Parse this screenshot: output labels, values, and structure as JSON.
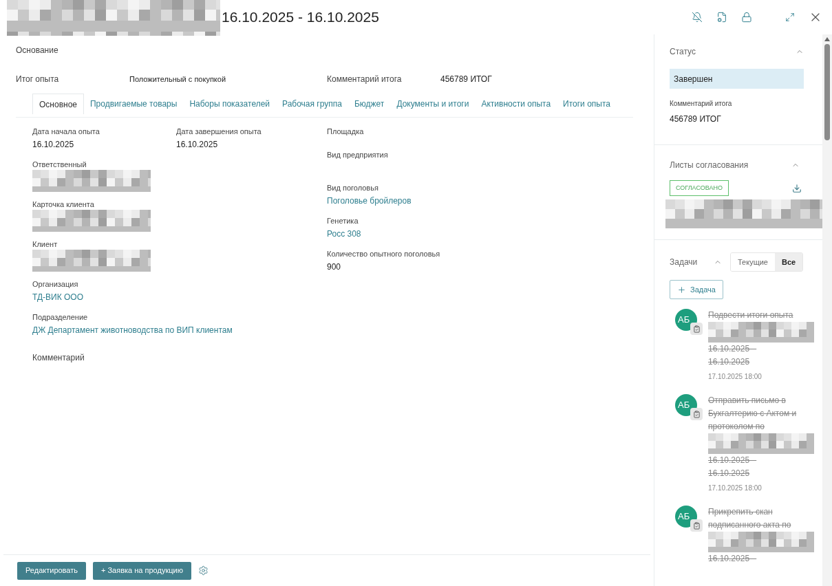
{
  "header": {
    "title": "16.10.2025 - 16.10.2025",
    "title_redacted": true
  },
  "summary": {
    "basis_label": "Основание",
    "result_label": "Итог опыта",
    "result_value": "Положительный с покупкой",
    "comment_label": "Комментарий итога",
    "comment_value": "456789 ИТОГ"
  },
  "tabs": [
    {
      "label": "Основное",
      "selected": true
    },
    {
      "label": "Продвигаемые товары",
      "selected": false
    },
    {
      "label": "Наборы показателей",
      "selected": false
    },
    {
      "label": "Рабочая группа",
      "selected": false
    },
    {
      "label": "Бюджет",
      "selected": false
    },
    {
      "label": "Документы и итоги",
      "selected": false
    },
    {
      "label": "Активности опыта",
      "selected": false
    },
    {
      "label": "Итоги опыта",
      "selected": false
    }
  ],
  "columns": [
    {
      "fields": [
        {
          "label": "Дата начала опыта",
          "value": "16.10.2025",
          "kind": "text"
        }
      ]
    },
    {
      "fields": [
        {
          "label": "Дата завершения опыта",
          "value": "16.10.2025",
          "kind": "text"
        }
      ]
    },
    {
      "fields": [
        {
          "label": "Площадка",
          "kind": "empty"
        },
        {
          "label": "Вид предприятия",
          "kind": "empty"
        }
      ]
    }
  ],
  "left_fields": [
    {
      "label": "Ответственный",
      "kind": "redacted"
    },
    {
      "label": "Карточка клиента",
      "kind": "redacted"
    },
    {
      "label": "Клиент",
      "kind": "redacted"
    },
    {
      "label": "Организация",
      "value": "ТД-ВИК ООО",
      "kind": "link"
    },
    {
      "label": "Подразделение",
      "value": "ДЖ Департамент животноводства по ВИП клиентам",
      "kind": "link"
    }
  ],
  "right_fields": [
    {
      "label": "Вид поголовья",
      "value": "Поголовье бройлеров",
      "kind": "link"
    },
    {
      "label": "Генетика",
      "value": "Росс 308",
      "kind": "link"
    },
    {
      "label": "Количество опытного поголовья",
      "value": "900",
      "kind": "text"
    }
  ],
  "comment_label": "Комментарий",
  "footer": {
    "buttons": [
      "Редактировать",
      "+ Заявка на продукцию"
    ]
  },
  "sidebar": {
    "status": {
      "title": "Статус",
      "expanded": true,
      "value": "Завершен",
      "comment_label": "Комментарий итога",
      "comment_value": "456789 ИТОГ"
    },
    "approval": {
      "title": "Листы согласования",
      "expanded": true,
      "badge": "СОГЛАСОВАНО"
    },
    "tasks": {
      "title": "Задачи",
      "expanded": true,
      "filters": [
        {
          "label": "Текущие",
          "selected": false
        },
        {
          "label": "Все",
          "selected": true
        }
      ],
      "add_button": "Задача",
      "items": [
        {
          "avatar": "АБ",
          "title": "Подвести итоги опыта",
          "done": true,
          "dates": [
            "16.10.2025 –",
            "16.10.2025"
          ],
          "due": "17.10.2025 18:00"
        },
        {
          "avatar": "АБ",
          "title": "Отправить письмо в Бухгалтерию с Актом и протоколом по",
          "done": true,
          "dates": [
            "16.10.2025 –",
            "16.10.2025"
          ],
          "due": "17.10.2025 18:00"
        },
        {
          "avatar": "АБ",
          "title": "Прикрепить скан подписанного акта по",
          "done": true,
          "dates": [
            "16.10.2025 –"
          ]
        }
      ]
    }
  }
}
